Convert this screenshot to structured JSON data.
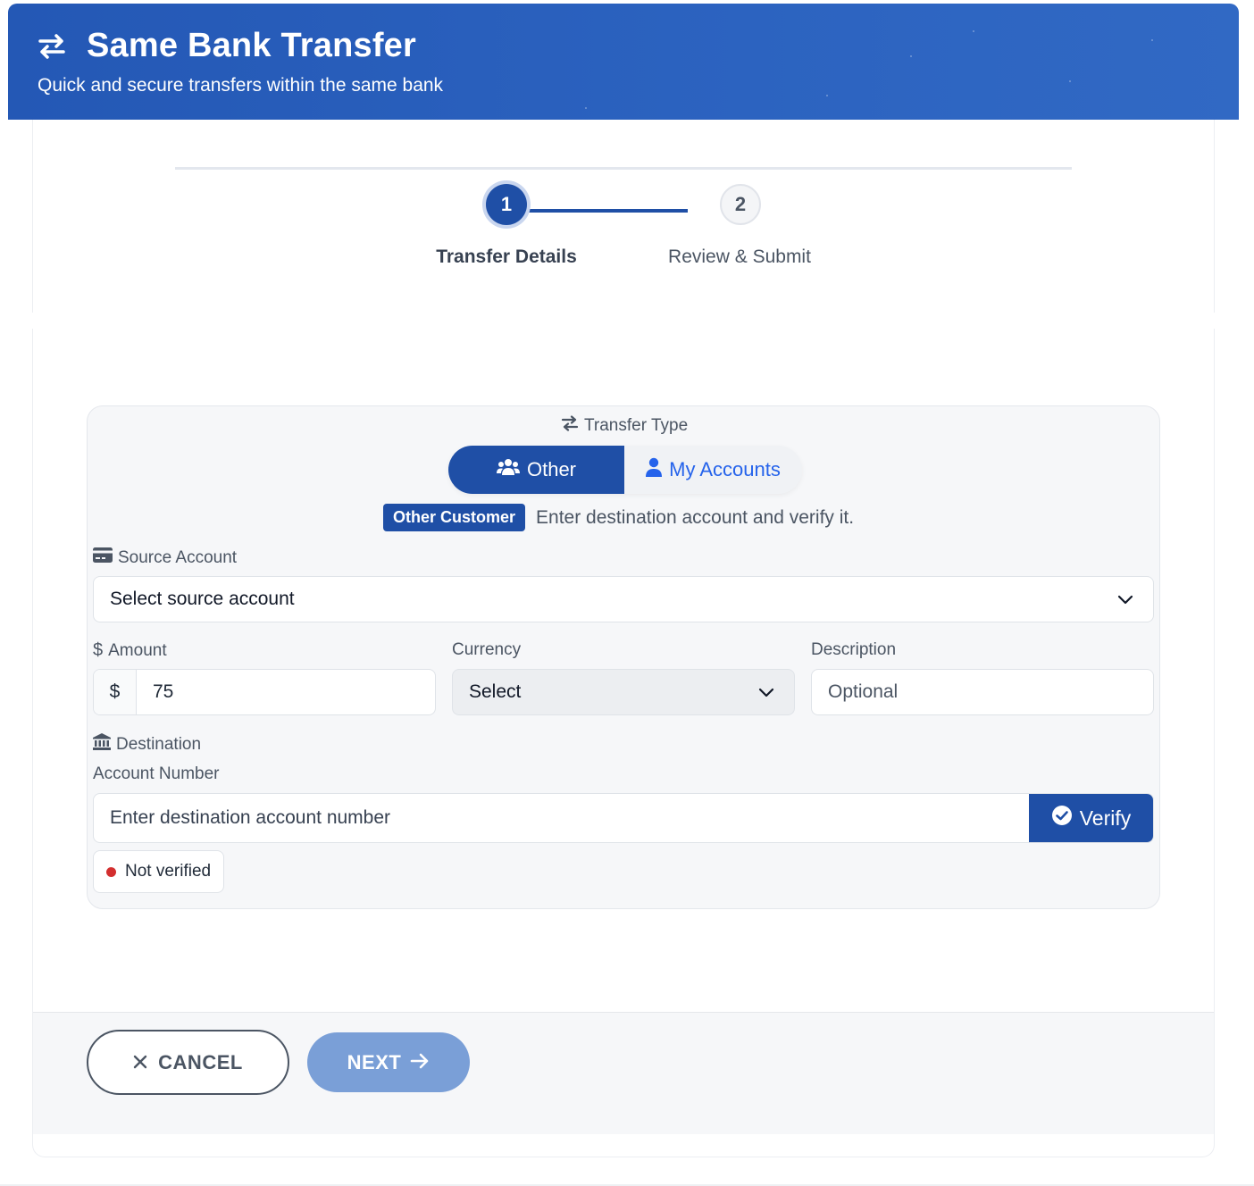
{
  "header": {
    "title": "Same Bank Transfer",
    "subtitle": "Quick and secure transfers within the same bank",
    "icon": "swap-arrows-icon",
    "color": "#2458b5"
  },
  "stepper": {
    "steps": [
      {
        "number": "1",
        "label": "Transfer Details",
        "active": true
      },
      {
        "number": "2",
        "label": "Review & Submit",
        "active": false
      }
    ]
  },
  "transfer_type": {
    "label": "Transfer Type",
    "options": [
      {
        "label": "Other",
        "icon": "users-icon",
        "selected": true
      },
      {
        "label": "My Accounts",
        "icon": "user-icon",
        "selected": false
      }
    ],
    "badge": "Other Customer",
    "hint": "Enter destination account and verify it."
  },
  "source_account": {
    "label": "Source Account",
    "value": "Select source account",
    "icon": "credit-card-icon"
  },
  "amount": {
    "label": "Amount",
    "prefix": "$",
    "value": "75"
  },
  "currency": {
    "label": "Currency",
    "value": "Select"
  },
  "description": {
    "label": "Description",
    "placeholder": "Optional"
  },
  "destination": {
    "section_label": "Destination",
    "field_label": "Account Number",
    "placeholder": "Enter destination account number",
    "verify_label": "Verify",
    "status": "Not verified",
    "status_color": "#d32f2f"
  },
  "footer": {
    "cancel_label": "CANCEL",
    "next_label": "NEXT"
  },
  "colors": {
    "primary": "#1f4fa6",
    "link": "#2563eb",
    "next_disabled": "#7a9fd7"
  }
}
